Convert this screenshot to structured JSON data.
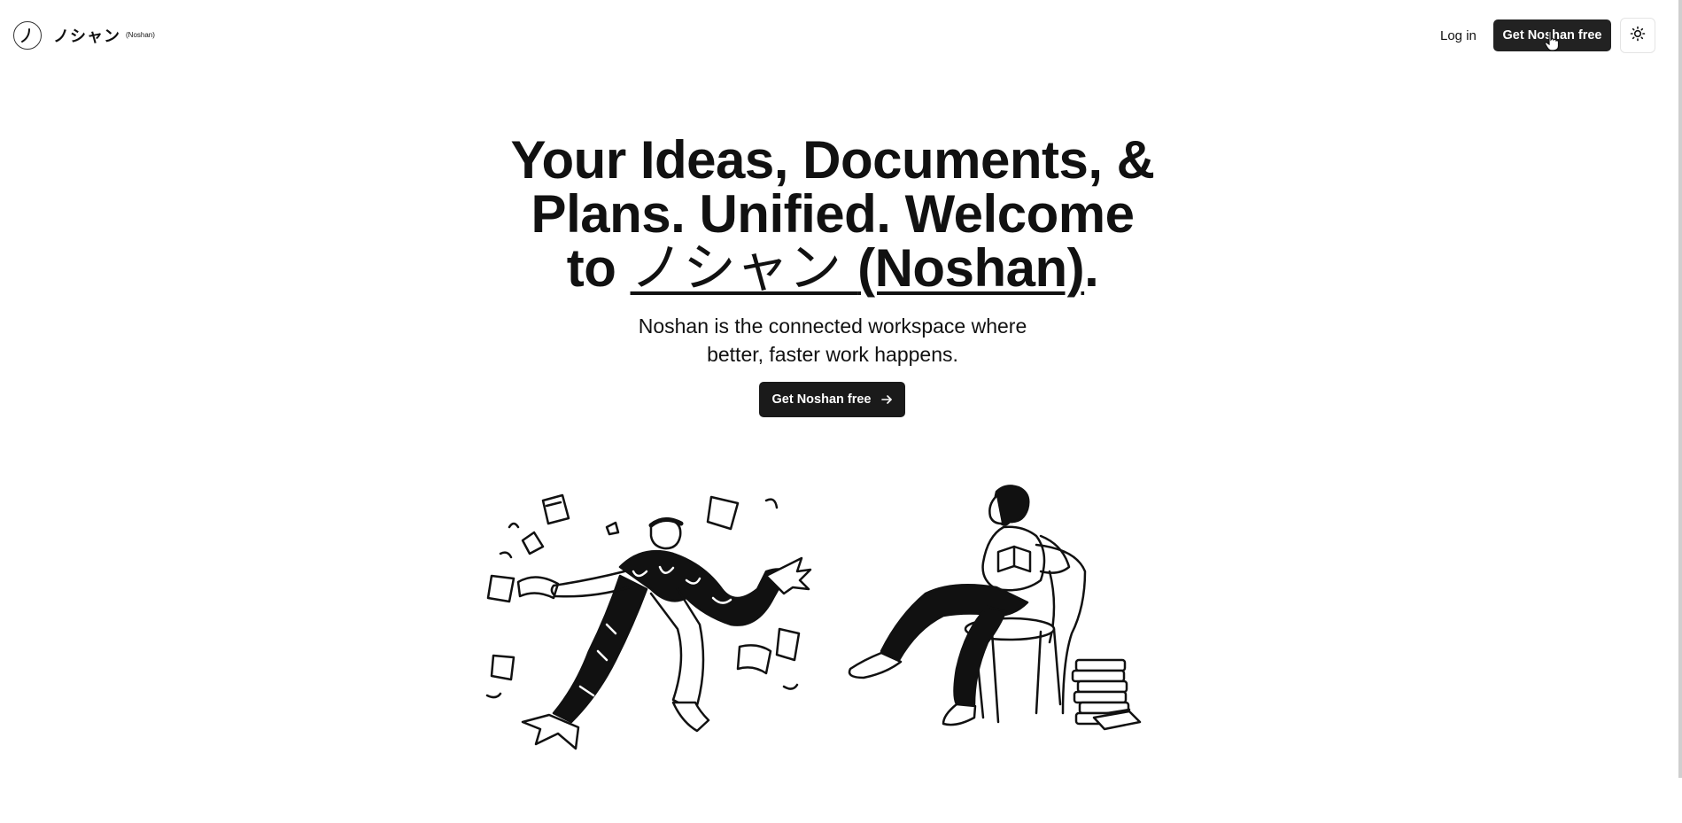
{
  "header": {
    "brand_name": "ノシャン",
    "brand_sub": "(Noshan)",
    "login_label": "Log in",
    "cta_label": "Get Noshan free",
    "theme_icon": "sun-icon"
  },
  "hero": {
    "title_line1": "Your Ideas, Documents, &",
    "title_line2": "Plans. Unified. Welcome",
    "title_to": "to ",
    "title_jp": "ノシャン ",
    "title_en": "(Noshan)",
    "title_period": ".",
    "subtitle_line1": "Noshan is the connected workspace where",
    "subtitle_line2": "better, faster work happens.",
    "cta_label": "Get Noshan free",
    "cta_icon": "arrow-right-icon"
  },
  "colors": {
    "button_bg": "#222222",
    "text": "#111111",
    "background": "#ffffff"
  }
}
